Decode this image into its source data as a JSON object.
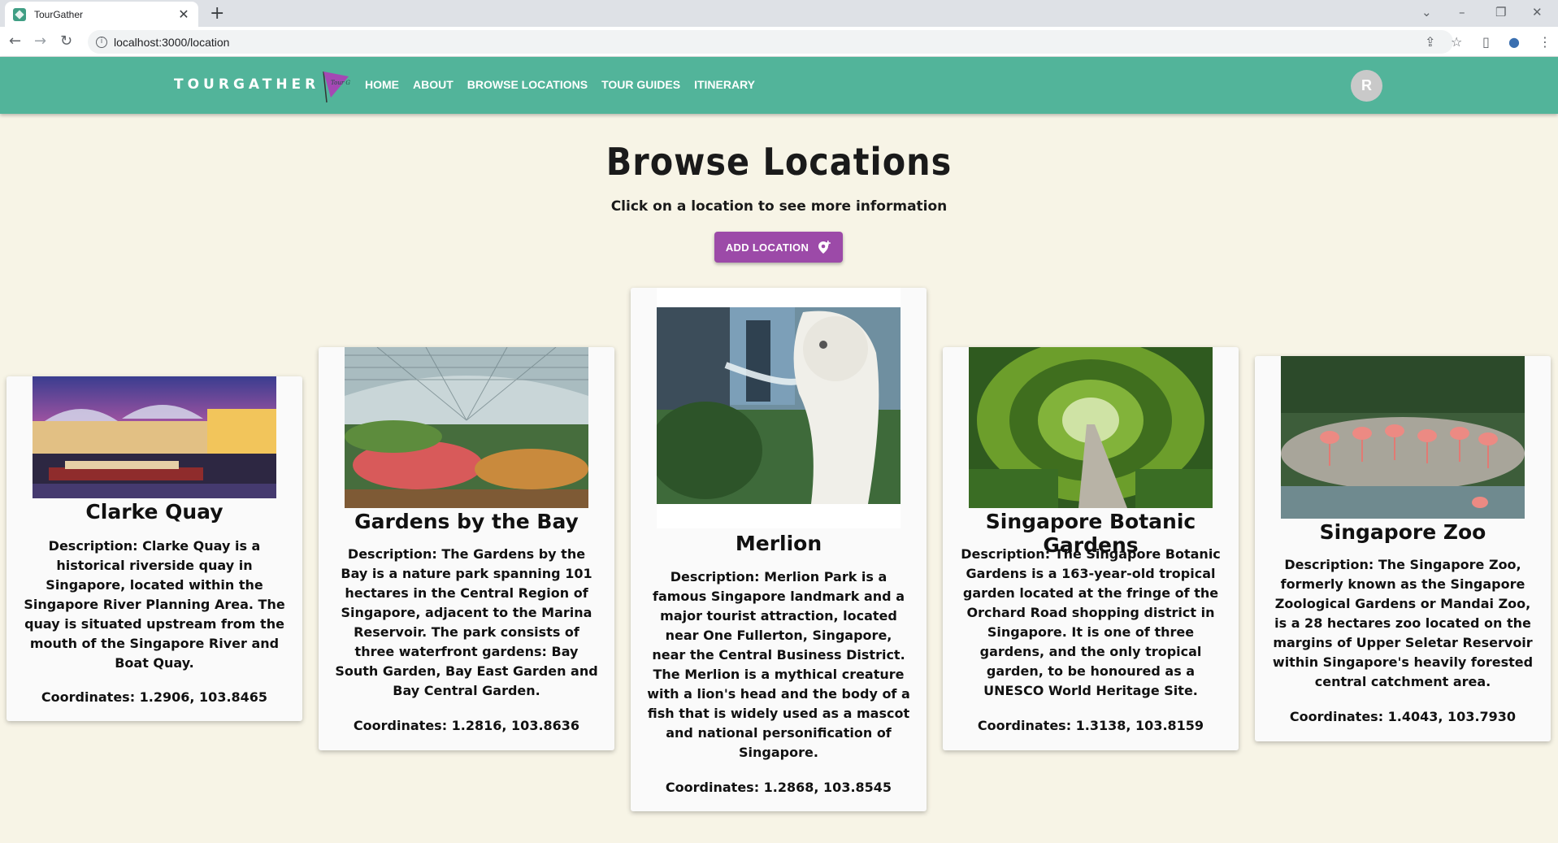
{
  "browser": {
    "tab_title": "TourGather",
    "url": "localhost:3000/location"
  },
  "header": {
    "brand": "TOURGATHER",
    "nav": [
      "HOME",
      "ABOUT",
      "BROWSE LOCATIONS",
      "TOUR GUIDES",
      "ITINERARY"
    ],
    "avatar_initial": "R",
    "logo_text": "Tour Gather"
  },
  "page": {
    "title": "Browse Locations",
    "subtitle": "Click on a location to see more information",
    "add_button_label": "ADD LOCATION"
  },
  "locations": [
    {
      "name": "Clarke Quay",
      "description": "Description: Clarke Quay is a historical riverside quay in Singapore, located within the Singapore River Planning Area. The quay is situated upstream from the mouth of the Singapore River and Boat Quay.",
      "coordinates": "Coordinates: 1.2906, 103.8465"
    },
    {
      "name": "Gardens by the Bay",
      "description": "Description: The Gardens by the Bay is a nature park spanning 101 hectares in the Central Region of Singapore, adjacent to the Marina Reservoir. The park consists of three waterfront gardens: Bay South Garden, Bay East Garden and Bay Central Garden.",
      "coordinates": "Coordinates: 1.2816, 103.8636"
    },
    {
      "name": "Merlion",
      "description": "Description: Merlion Park is a famous Singapore landmark and a major tourist attraction, located near One Fullerton, Singapore, near the Central Business District. The Merlion is a mythical creature with a lion's head and the body of a fish that is widely used as a mascot and national personification of Singapore.",
      "coordinates": "Coordinates: 1.2868, 103.8545"
    },
    {
      "name": "Singapore Botanic Gardens",
      "description": "Description: The Singapore Botanic Gardens is a 163-year-old tropical garden located at the fringe of the Orchard Road shopping district in Singapore. It is one of three gardens, and the only tropical garden, to be honoured as a UNESCO World Heritage Site.",
      "coordinates": "Coordinates: 1.3138, 103.8159"
    },
    {
      "name": "Singapore Zoo",
      "description": "Description: The Singapore Zoo, formerly known as the Singapore Zoological Gardens or Mandai Zoo, is a 28 hectares zoo located on the margins of Upper Seletar Reservoir within Singapore's heavily forested central catchment area.",
      "coordinates": "Coordinates: 1.4043, 103.7930"
    }
  ]
}
